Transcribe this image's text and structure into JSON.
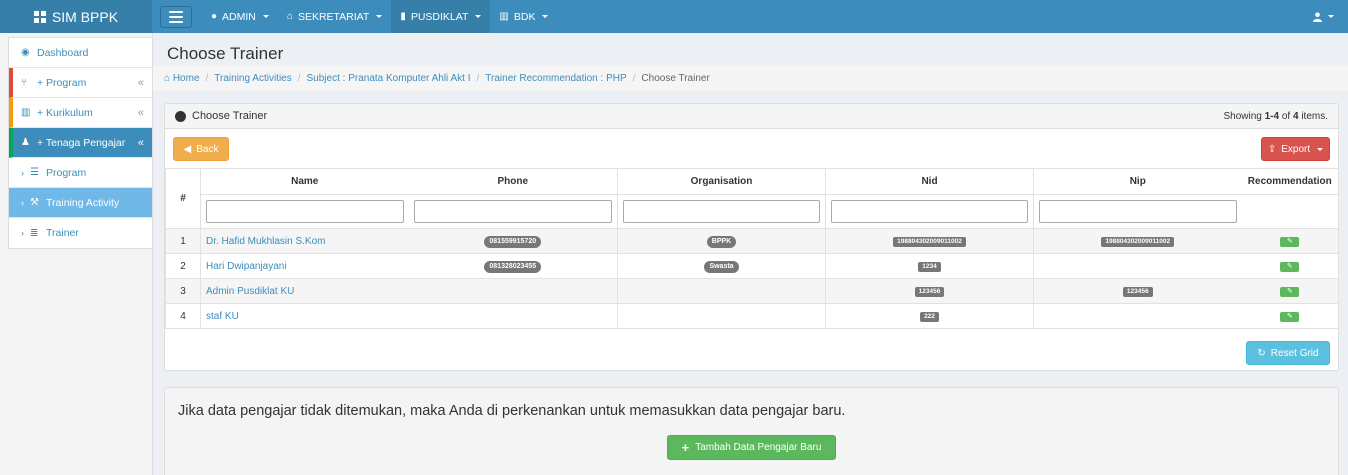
{
  "brand": "SIM BPPK",
  "nav": [
    {
      "icon": "android-icon",
      "glyph": "●",
      "label": "ADMIN"
    },
    {
      "icon": "home-icon",
      "glyph": "⌂",
      "label": "SEKRETARIAT"
    },
    {
      "icon": "building-icon",
      "glyph": "▮",
      "label": "PUSDIKLAT"
    },
    {
      "icon": "bank-icon",
      "glyph": "▥",
      "label": "BDK"
    }
  ],
  "sidebar": {
    "dashboard": "Dashboard",
    "program": "+ Program",
    "kurikulum": "+ Kurikulum",
    "tenaga": "+ Tenaga Pengajar",
    "sub_program": "Program",
    "sub_training": "Training Activity",
    "sub_trainer": "Trainer",
    "chev": "«",
    "arrow": "›"
  },
  "page_title": "Choose Trainer",
  "breadcrumb": {
    "home": "Home",
    "b1": "Training Activities",
    "b2": "Subject : Pranata Komputer Ahli Akt I",
    "b3": "Trainer Recommendation : PHP",
    "current": "Choose Trainer",
    "sep": "/"
  },
  "panel": {
    "title": "Choose Trainer",
    "summary_pre": "Showing ",
    "summary_range": "1-4",
    "summary_mid": " of ",
    "summary_total": "4",
    "summary_post": " items.",
    "back": "Back",
    "export": "Export",
    "reset": "Reset Grid"
  },
  "columns": {
    "num": "#",
    "name": "Name",
    "phone": "Phone",
    "org": "Organisation",
    "nid": "Nid",
    "nip": "Nip",
    "rec": "Recommendation"
  },
  "rows": [
    {
      "no": "1",
      "name": "Dr. Hafid Mukhlasin S.Kom",
      "phone": "081559915720",
      "org": "BPPK",
      "nid": "198804302009011002",
      "nip": "198804302009011002"
    },
    {
      "no": "2",
      "name": "Hari Dwipanjayani",
      "phone": "081328023455",
      "org": "Swasta",
      "nid": "1234",
      "nip": ""
    },
    {
      "no": "3",
      "name": "Admin Pusdiklat KU",
      "phone": "",
      "org": "",
      "nid": "123456",
      "nip": "123456"
    },
    {
      "no": "4",
      "name": "staf KU",
      "phone": "",
      "org": "",
      "nid": "222",
      "nip": ""
    }
  ],
  "rec_glyph": "✎",
  "footer": {
    "message": "Jika data pengajar tidak ditemukan, maka Anda di perkenankan untuk memasukkan data pengajar baru.",
    "add_button": "Tambah Data Pengajar Baru",
    "plus": "+"
  }
}
